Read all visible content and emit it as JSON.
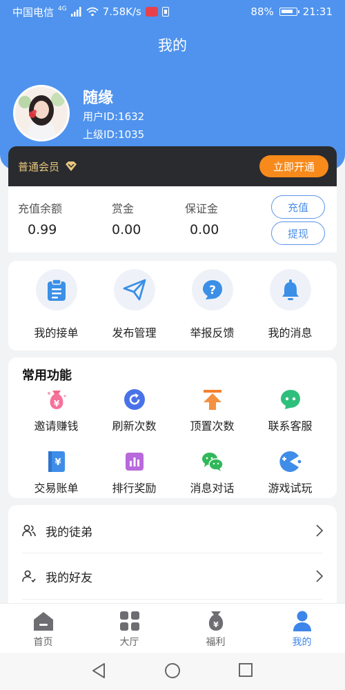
{
  "status_bar": {
    "carrier": "中国电信",
    "network": "4G",
    "speed": "7.58K/s",
    "battery": "88%",
    "time": "21:31"
  },
  "header": {
    "title": "我的"
  },
  "profile": {
    "name": "随缘",
    "user_id": "用户ID:1632",
    "parent_id": "上级ID:1035"
  },
  "vip": {
    "label": "普通会员",
    "open_button": "立即开通",
    "accent": "#f78a1b"
  },
  "balance": {
    "items": [
      {
        "label": "充值余额",
        "value": "0.99"
      },
      {
        "label": "赏金",
        "value": "0.00"
      },
      {
        "label": "保证金",
        "value": "0.00"
      }
    ],
    "recharge_button": "充值",
    "withdraw_button": "提现"
  },
  "quick_actions": [
    {
      "label": "我的接单",
      "icon": "clipboard-icon"
    },
    {
      "label": "发布管理",
      "icon": "paper-plane-icon"
    },
    {
      "label": "举报反馈",
      "icon": "question-icon"
    },
    {
      "label": "我的消息",
      "icon": "bell-icon"
    }
  ],
  "common_functions": {
    "title": "常用功能",
    "items": [
      {
        "label": "邀请赚钱",
        "icon": "money-bag-icon"
      },
      {
        "label": "刷新次数",
        "icon": "refresh-icon"
      },
      {
        "label": "顶置次数",
        "icon": "pin-top-icon"
      },
      {
        "label": "联系客服",
        "icon": "chat-bubble-icon"
      },
      {
        "label": "交易账单",
        "icon": "bill-icon"
      },
      {
        "label": "排行奖励",
        "icon": "ranking-icon"
      },
      {
        "label": "消息对话",
        "icon": "wechat-icon"
      },
      {
        "label": "游戏试玩",
        "icon": "game-icon"
      }
    ]
  },
  "menu": [
    {
      "label": "我的徒弟",
      "icon": "people-icon"
    },
    {
      "label": "我的好友",
      "icon": "friend-icon"
    }
  ],
  "tabbar": {
    "items": [
      {
        "label": "首页",
        "icon": "home-icon",
        "active": false
      },
      {
        "label": "大厅",
        "icon": "grid-icon",
        "active": false
      },
      {
        "label": "福利",
        "icon": "welfare-icon",
        "active": false
      },
      {
        "label": "我的",
        "icon": "user-icon",
        "active": true
      }
    ],
    "active_color": "#3d85e8"
  },
  "theme": {
    "primary": "#4f93ee",
    "dark": "#2a2b2f"
  }
}
